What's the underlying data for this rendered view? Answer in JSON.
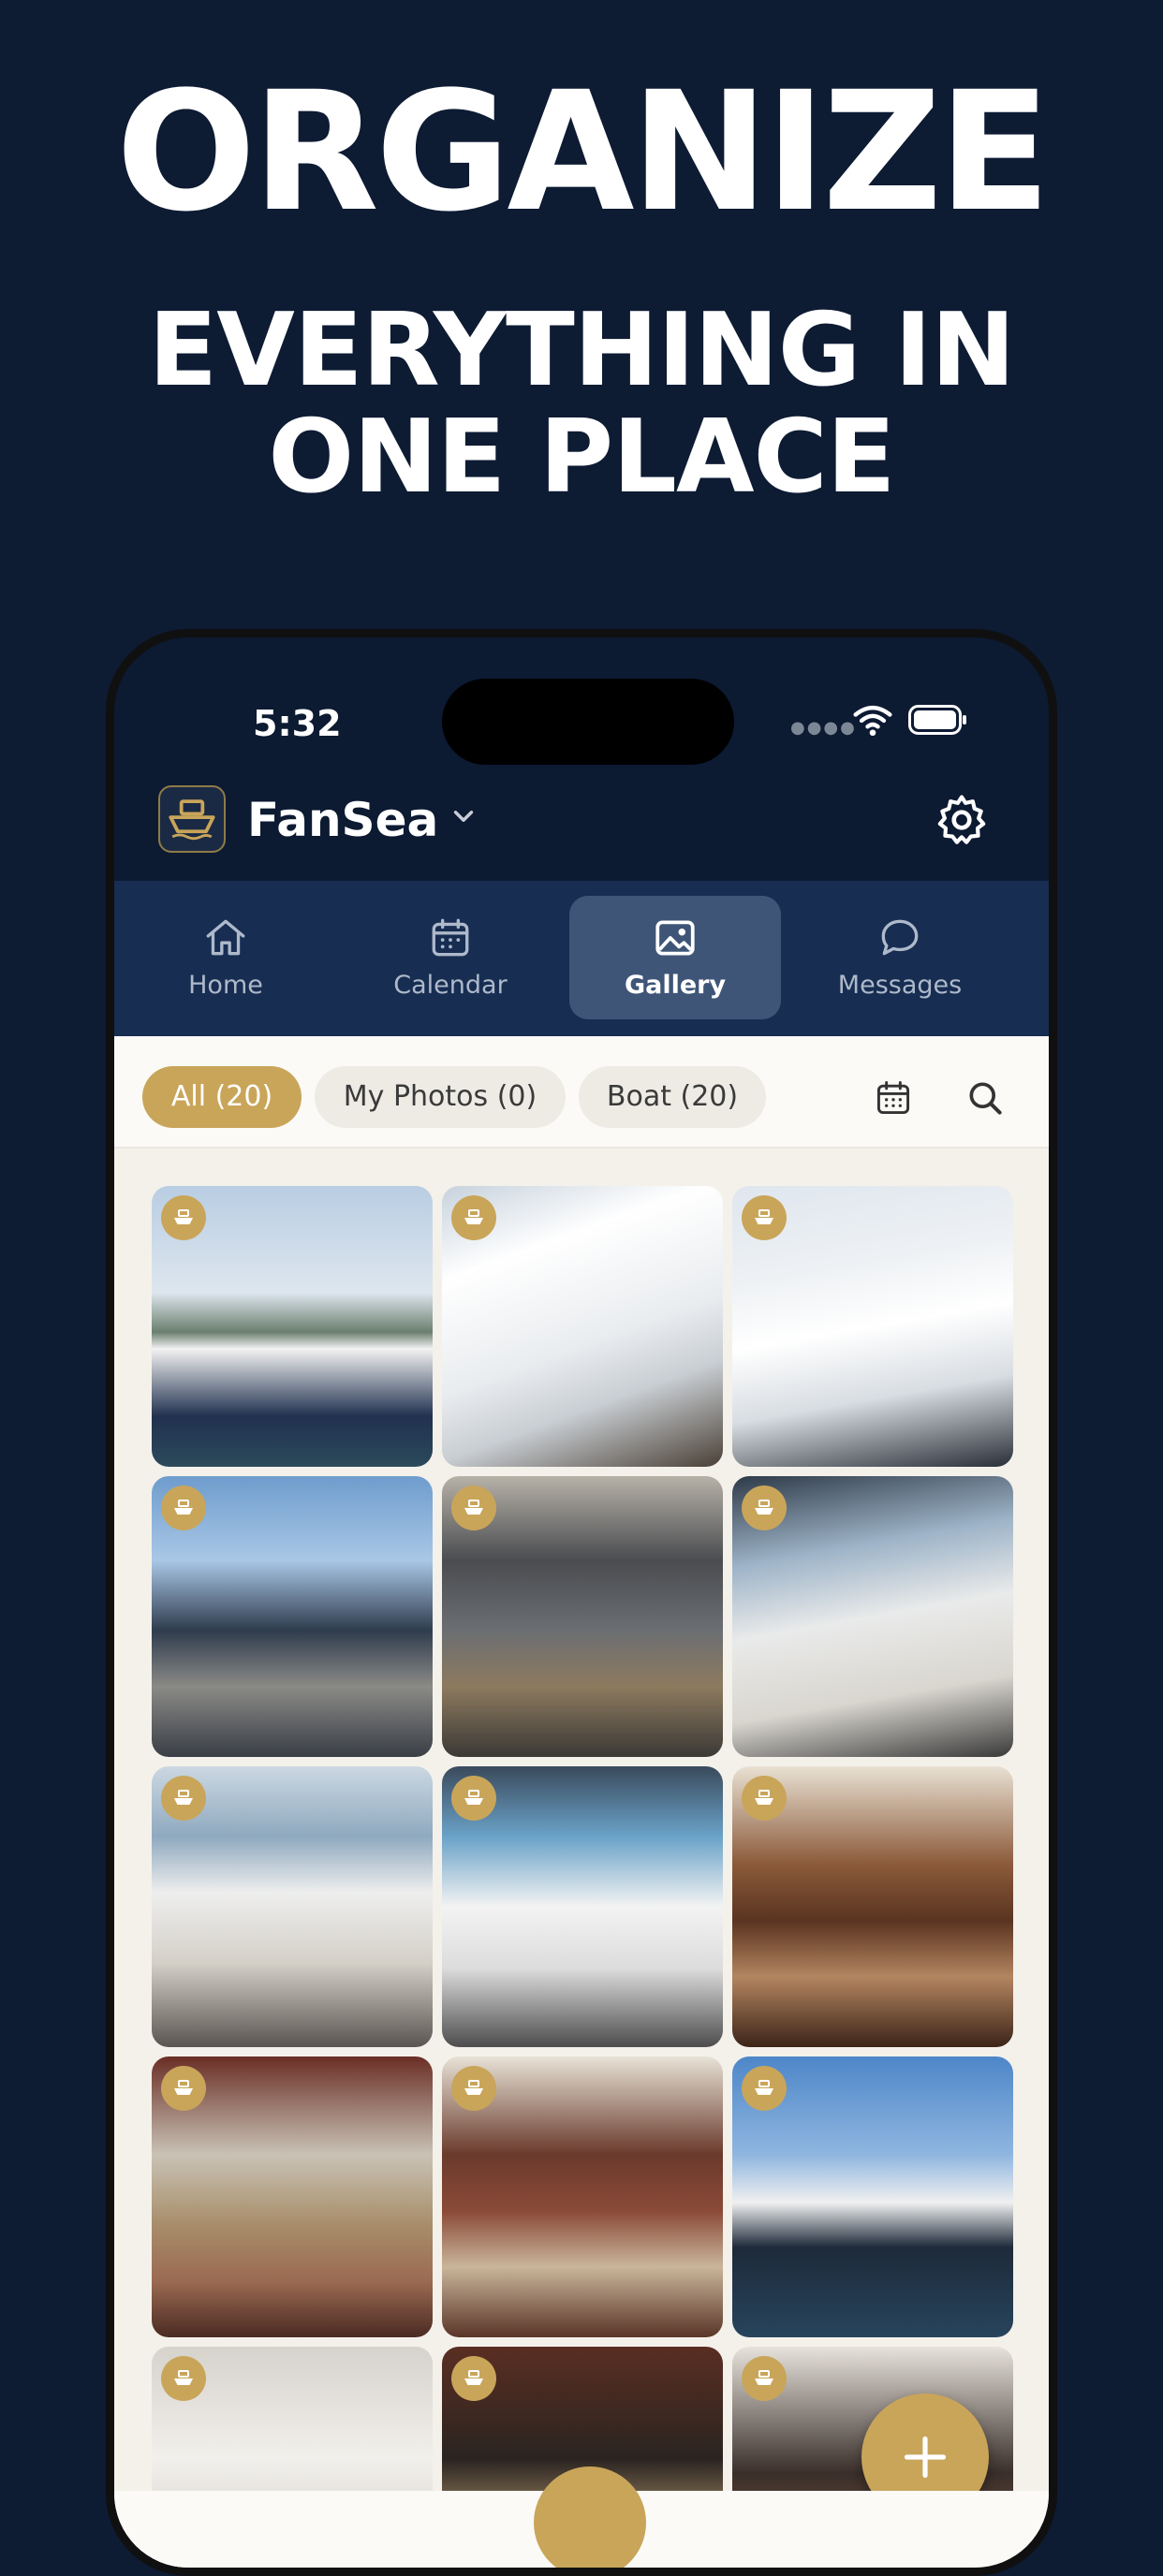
{
  "hero": {
    "title": "ORGANIZE",
    "subtitle_line1": "EVERYTHING IN",
    "subtitle_line2": "ONE PLACE"
  },
  "status_bar": {
    "time": "5:32"
  },
  "header": {
    "app_name": "FanSea",
    "logo_icon": "boat-logo-icon",
    "settings_icon": "gear-icon"
  },
  "tabs": [
    {
      "label": "Home",
      "icon": "house-icon",
      "active": false
    },
    {
      "label": "Calendar",
      "icon": "calendar-icon",
      "active": false
    },
    {
      "label": "Gallery",
      "icon": "gallery-icon",
      "active": true
    },
    {
      "label": "Messages",
      "icon": "chat-bubble-icon",
      "active": false
    }
  ],
  "filters": [
    {
      "label": "All (20)",
      "active": true
    },
    {
      "label": "My Photos (0)",
      "active": false
    },
    {
      "label": "Boat (20)",
      "active": false
    }
  ],
  "gallery": {
    "photos": [
      "exterior-sky",
      "exterior-deck",
      "exterior-bow",
      "helm-person",
      "dashboard",
      "cockpit",
      "cockpit-seats",
      "cockpit-lounge",
      "cabin-salon",
      "cabin-galley",
      "cabin-kitchen",
      "exterior-marina",
      "head",
      "cabin-stairs",
      "cabin-berth"
    ]
  },
  "colors": {
    "navy": "#0d1b33",
    "tab_bar": "#172d52",
    "gold": "#c9a55a",
    "gallery_bg": "#f4f1eb"
  }
}
